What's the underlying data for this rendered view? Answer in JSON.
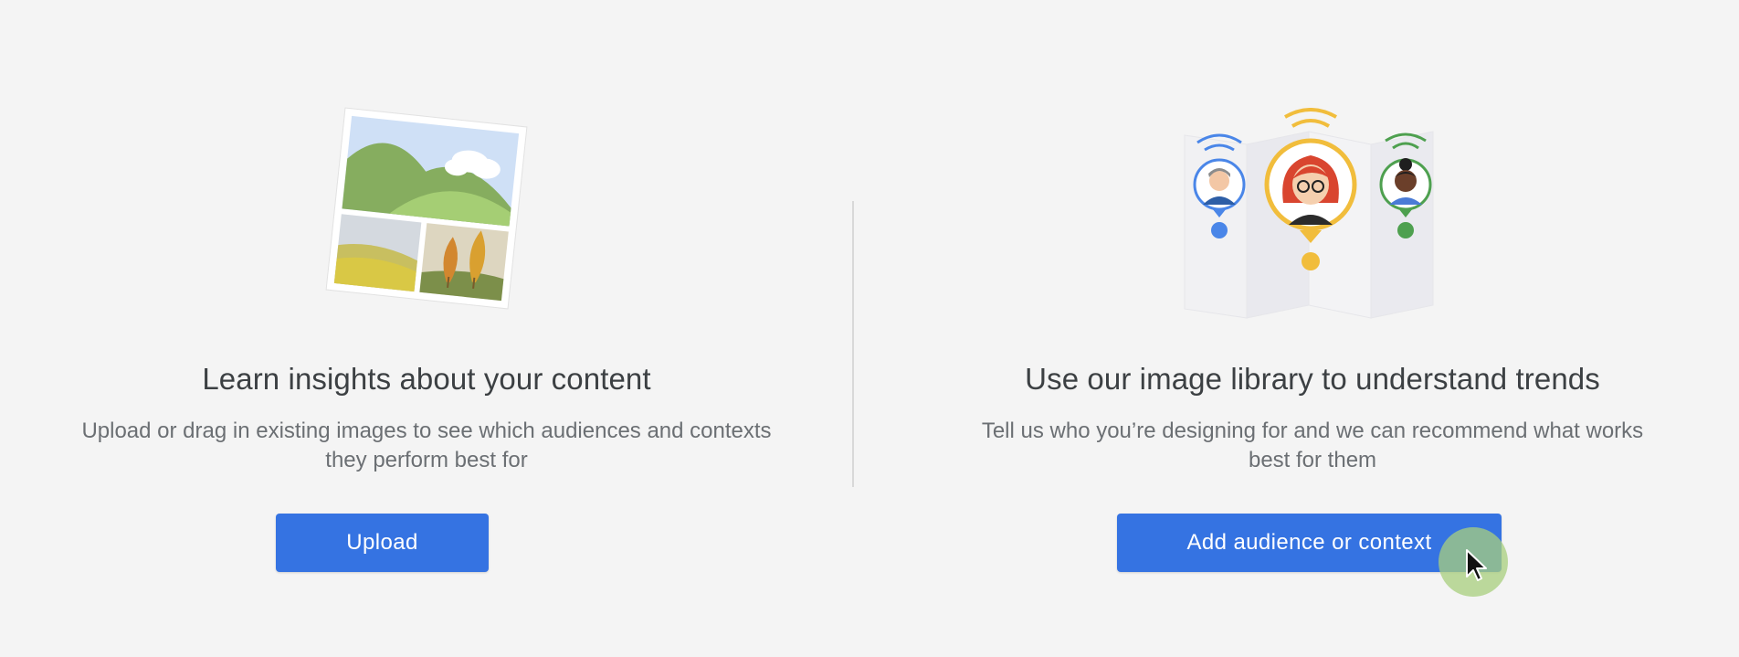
{
  "left_panel": {
    "heading": "Learn insights about your content",
    "description": "Upload or drag in existing images to see which audiences and contexts they perform best for",
    "button_label": "Upload"
  },
  "right_panel": {
    "heading": "Use our image library to understand trends",
    "description": "Tell us who you’re designing for and we can recommend what works best for them",
    "button_label": "Add audience or context"
  },
  "icons": {
    "left_illustration": "photo-collage-icon",
    "right_illustration": "audience-map-icon",
    "cursor": "mouse-pointer-icon"
  },
  "colors": {
    "background": "#f4f4f4",
    "primary_button": "#3573e2",
    "heading_text": "#3c4043",
    "body_text": "#6b6f73",
    "pin_blue": "#4a86e8",
    "pin_yellow": "#f1bd3c",
    "pin_green": "#4ea04f"
  }
}
